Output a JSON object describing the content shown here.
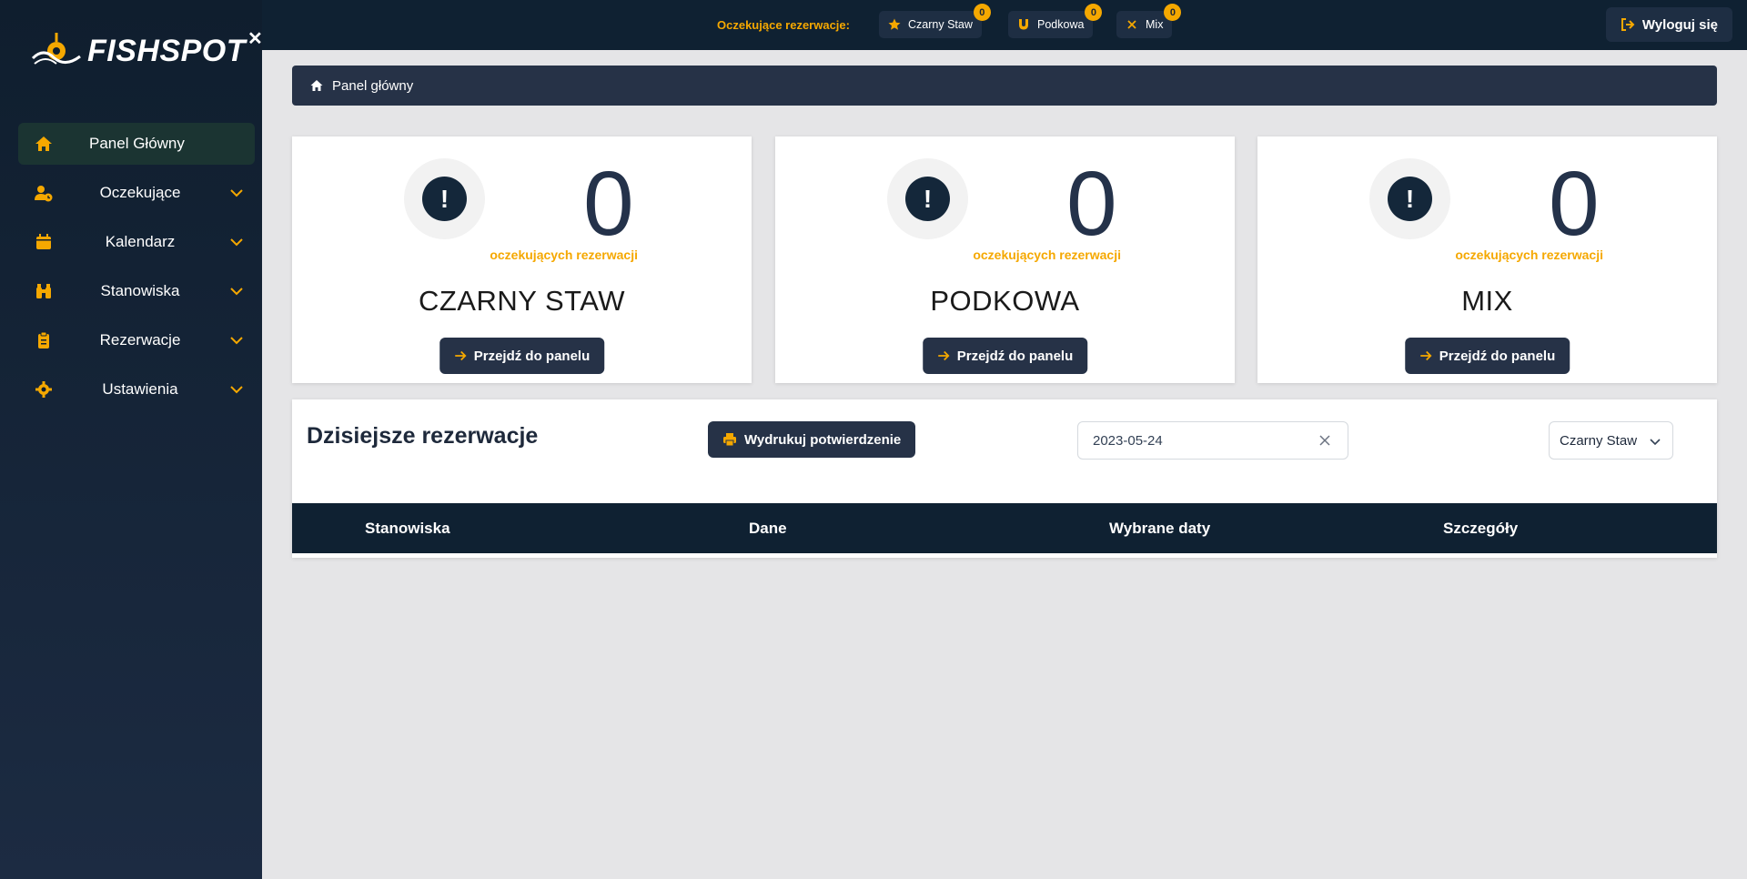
{
  "app": {
    "brand": "FISHSPOT",
    "brand_suffix": "✕",
    "accent": "#f5a800",
    "dark": "#0f2132"
  },
  "sidebar": {
    "items": [
      {
        "label": "Panel Główny",
        "icon": "home-icon",
        "active": true
      },
      {
        "label": "Oczekujące",
        "icon": "user-clock-icon"
      },
      {
        "label": "Kalendarz",
        "icon": "calendar-icon"
      },
      {
        "label": "Stanowiska",
        "icon": "binoculars-icon"
      },
      {
        "label": "Rezerwacje",
        "icon": "clipboard-icon"
      },
      {
        "label": "Ustawienia",
        "icon": "gear-icon"
      }
    ]
  },
  "topbar": {
    "pending_label": "Oczekujące rezerwacje:",
    "chips": [
      {
        "label": "Czarny Staw",
        "icon": "star-icon",
        "count": "0"
      },
      {
        "label": "Podkowa",
        "icon": "magnet-icon",
        "count": "0"
      },
      {
        "label": "Mix",
        "icon": "x-icon",
        "count": "0"
      }
    ],
    "logout_label": "Wyloguj się"
  },
  "breadcrumb": {
    "label": "Panel główny"
  },
  "cards": [
    {
      "count": "0",
      "subtitle": "oczekujących rezerwacji",
      "title": "CZARNY STAW",
      "button": "Przejdź do panelu"
    },
    {
      "count": "0",
      "subtitle": "oczekujących rezerwacji",
      "title": "PODKOWA",
      "button": "Przejdź do panelu"
    },
    {
      "count": "0",
      "subtitle": "oczekujących rezerwacji",
      "title": "MIX",
      "button": "Przejdź do panelu"
    }
  ],
  "today": {
    "title": "Dzisiejsze rezerwacje",
    "print_label": "Wydrukuj potwierdzenie",
    "date_value": "2023-05-24",
    "select_value": "Czarny Staw",
    "columns": [
      "Stanowiska",
      "Dane",
      "Wybrane daty",
      "Szczegóły"
    ]
  }
}
